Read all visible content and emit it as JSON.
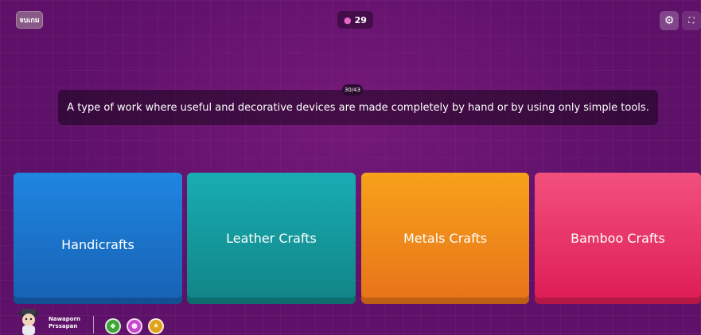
{
  "header": {
    "exit_label": "จบเกม",
    "streak_count": "29",
    "streak_icon": "gem-icon",
    "settings_icon": "gear-icon",
    "fullscreen_icon": "fullscreen-icon"
  },
  "question": {
    "counter": "30/43",
    "text": "A type of work where useful and decorative devices are made completely by hand or by using only simple tools."
  },
  "options": [
    {
      "label": "Handicrafts",
      "color": "#1f86e0"
    },
    {
      "label": "Leather Crafts",
      "color": "#18adb3"
    },
    {
      "label": "Metals Crafts",
      "color": "#f7a21a"
    },
    {
      "label": "Bamboo Crafts",
      "color": "#f2507d"
    }
  ],
  "player": {
    "first_name": "Nawaporn",
    "last_name": "Prssapan",
    "powerups": [
      "powerup-green-icon",
      "powerup-purple-icon",
      "powerup-gold-icon"
    ]
  }
}
